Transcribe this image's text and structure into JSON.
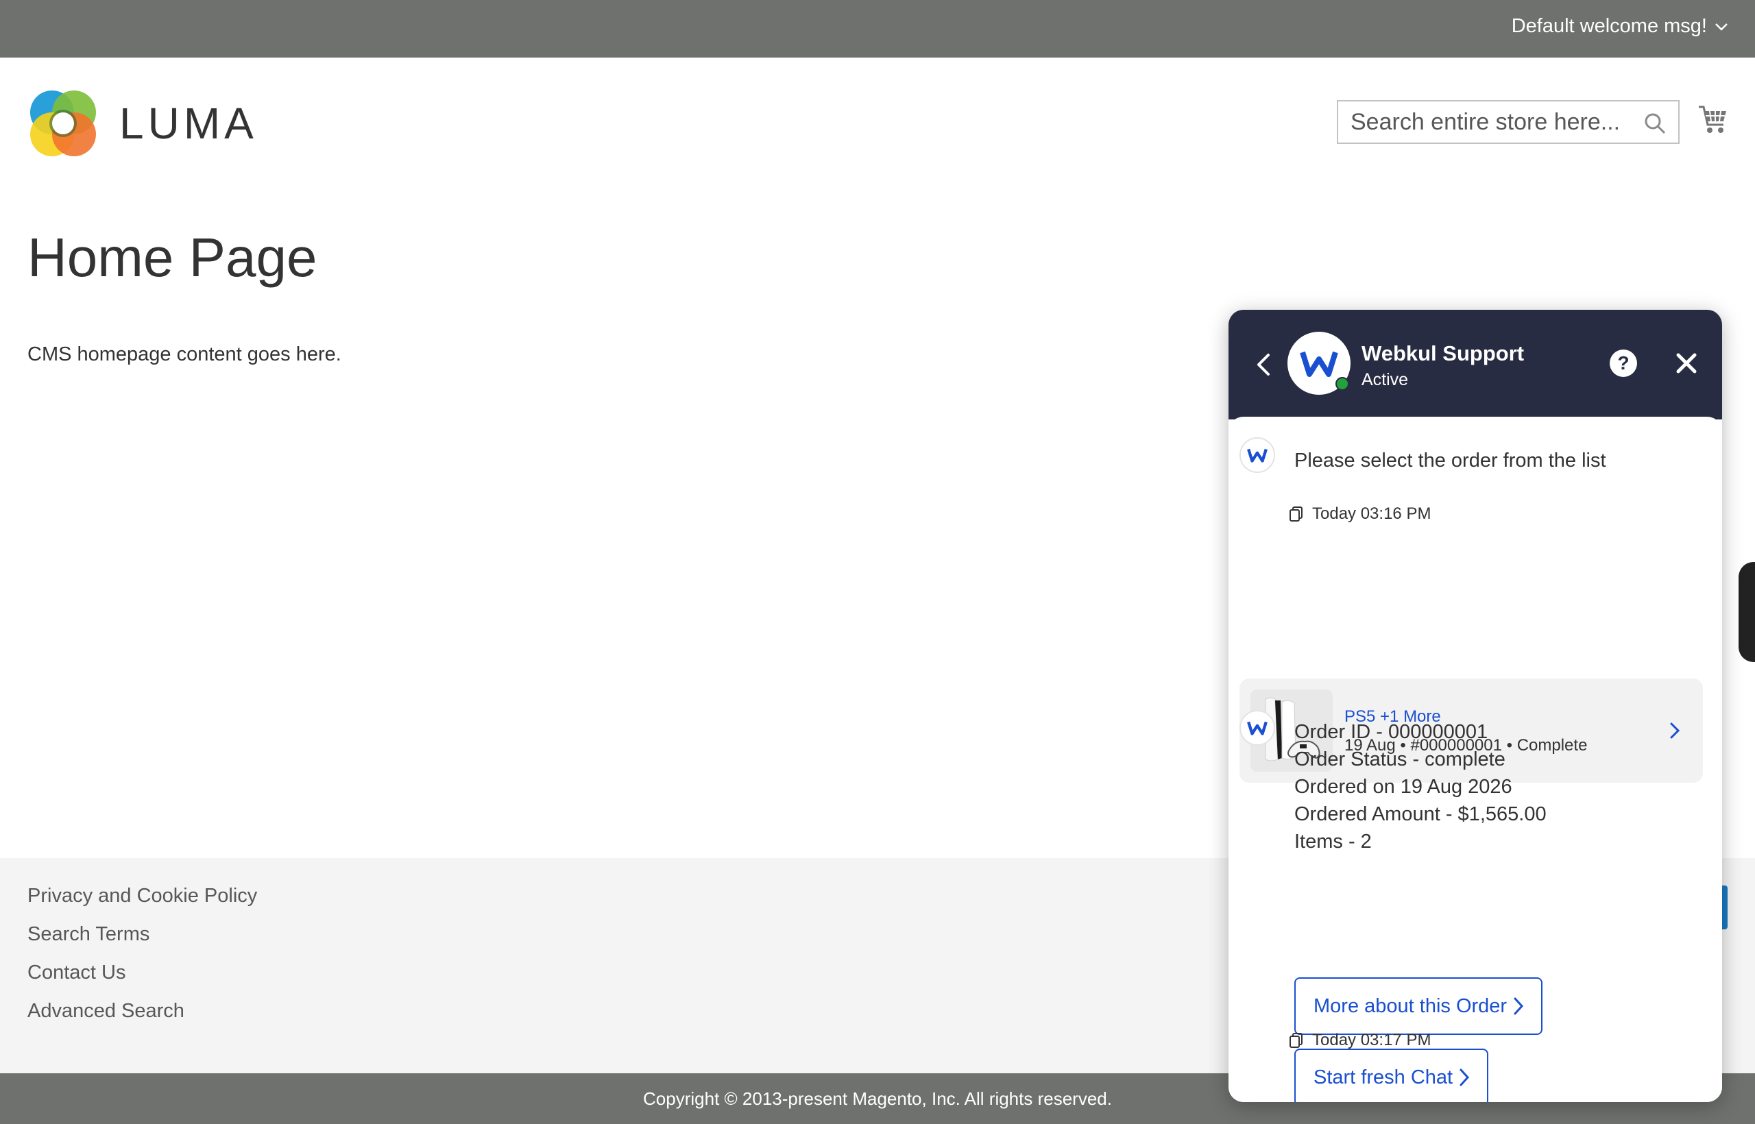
{
  "topbar": {
    "welcome": "Default welcome msg!"
  },
  "header": {
    "logo_text": "LUMA",
    "search_placeholder": "Search entire store here..."
  },
  "main": {
    "title": "Home Page",
    "content": "CMS homepage content goes here."
  },
  "footer": {
    "links": [
      "Privacy and Cookie Policy",
      "Search Terms",
      "Contact Us",
      "Advanced Search"
    ],
    "copyright": "Copyright © 2013-present Magento, Inc. All rights reserved."
  },
  "chat": {
    "agent_name": "Webkul Support",
    "agent_status": "Active",
    "help_label": "?",
    "messages": [
      {
        "text": "Please select the order from the list",
        "time": "Today 03:16 PM"
      }
    ],
    "order_card": {
      "title": "PS5 +1 More",
      "meta": "19 Aug • #000000001 • Complete"
    },
    "order_details": {
      "order_id": "Order ID - 000000001",
      "status": "Order Status - complete",
      "ordered_on": "Ordered on 19 Aug 2026",
      "amount": "Ordered Amount - $1,565.00",
      "items": "Items - 2"
    },
    "buttons": {
      "more": "More about this Order",
      "fresh": "Start fresh Chat"
    },
    "second_time": "Today 03:17 PM"
  },
  "colors": {
    "topbar": "#6e716e",
    "chat_header": "#282c42",
    "accent_blue": "#1a4fd0",
    "online": "#22a23c"
  }
}
